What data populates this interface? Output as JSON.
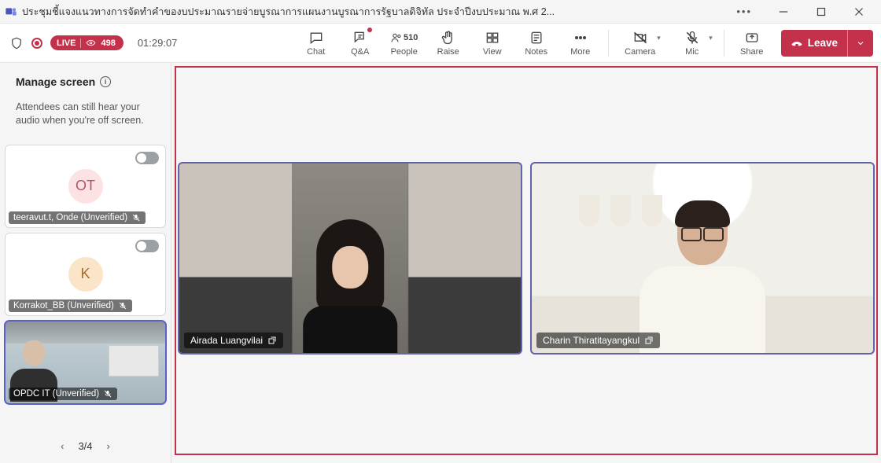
{
  "window": {
    "title": "ประชุมชี้แจงแนวทางการจัดทำคำของบประมาณรายจ่ายบูรณาการแผนงานบูรณาการรัฐบาลดิจิทัล ประจำปีงบประมาณ พ.ศ 2..."
  },
  "status": {
    "live_label": "LIVE",
    "viewers": "498",
    "elapsed": "01:29:07"
  },
  "toolbar": {
    "chat": "Chat",
    "qa": "Q&A",
    "people": "People",
    "people_count": "510",
    "raise": "Raise",
    "view": "View",
    "notes": "Notes",
    "more": "More",
    "camera": "Camera",
    "mic": "Mic",
    "share": "Share",
    "leave": "Leave"
  },
  "sidebar": {
    "title": "Manage screen",
    "subtitle": "Attendees can still hear your audio when you're off screen.",
    "pager": "3/4",
    "participants": [
      {
        "initials": "OT",
        "name": "teeravut.t, Onde (Unverified)",
        "avatar": "pink"
      },
      {
        "initials": "K",
        "name": "Korrakot_BB (Unverified)",
        "avatar": "yellow"
      },
      {
        "initials": "",
        "name": "OPDC IT (Unverified)",
        "avatar": "video"
      }
    ]
  },
  "stage": {
    "speakers": [
      {
        "name": "Airada Luangvilai"
      },
      {
        "name": "Charin Thiratitayangkul"
      }
    ]
  }
}
